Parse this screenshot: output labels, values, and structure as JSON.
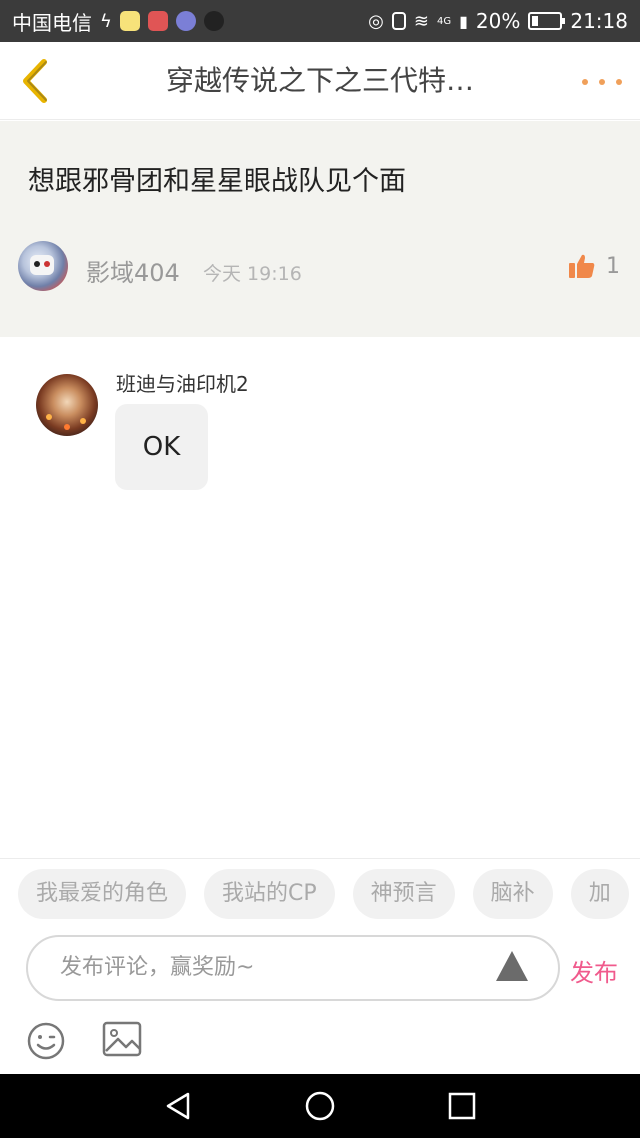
{
  "status_bar": {
    "carrier": "中国电信",
    "battery": "20%",
    "time": "21:18",
    "signal_label": "4G"
  },
  "header": {
    "title": "穿越传说之下之三代特…"
  },
  "post": {
    "title": "想跟邪骨团和星星眼战队见个面",
    "author": "影域404",
    "time": "今天 19:16",
    "likes": "1"
  },
  "comment": {
    "author": "班迪与油印机2",
    "text": "OK"
  },
  "bottom": {
    "tags": [
      "我最爱的角色",
      "我站的CP",
      "神预言",
      "脑补",
      "加"
    ],
    "input_placeholder": "发布评论，赢奖励~",
    "publish_label": "发布"
  },
  "colors": {
    "accent": "#f05a8c",
    "like": "#f0884a",
    "back_arrow": "#e8b400",
    "more_dots": "#f0a05a"
  }
}
